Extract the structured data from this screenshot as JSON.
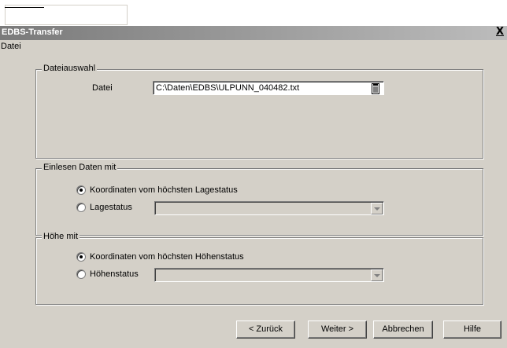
{
  "window": {
    "title": "EDBS-Transfer",
    "close_glyph": "X"
  },
  "menu": {
    "items": [
      {
        "label": "Datei"
      }
    ]
  },
  "file_group": {
    "legend": "Dateiauswahl",
    "file_label": "Datei",
    "file_path": "C:\\Daten\\EDBS\\ULPUNN_040482.txt",
    "browse_icon": "document-icon"
  },
  "read_group": {
    "legend": "Einlesen Daten mit",
    "option_highest": "Koordinaten vom höchsten Lagestatus",
    "option_status": "Lagestatus",
    "selected": "highest",
    "combo_value": ""
  },
  "height_group": {
    "legend": "Höhe mit",
    "option_highest": "Koordinaten vom höchsten Höhenstatus",
    "option_status": "Höhenstatus",
    "selected": "highest",
    "combo_value": ""
  },
  "buttons": {
    "back": "< Zurück",
    "next": "Weiter >",
    "cancel": "Abbrechen",
    "help": "Hilfe"
  }
}
